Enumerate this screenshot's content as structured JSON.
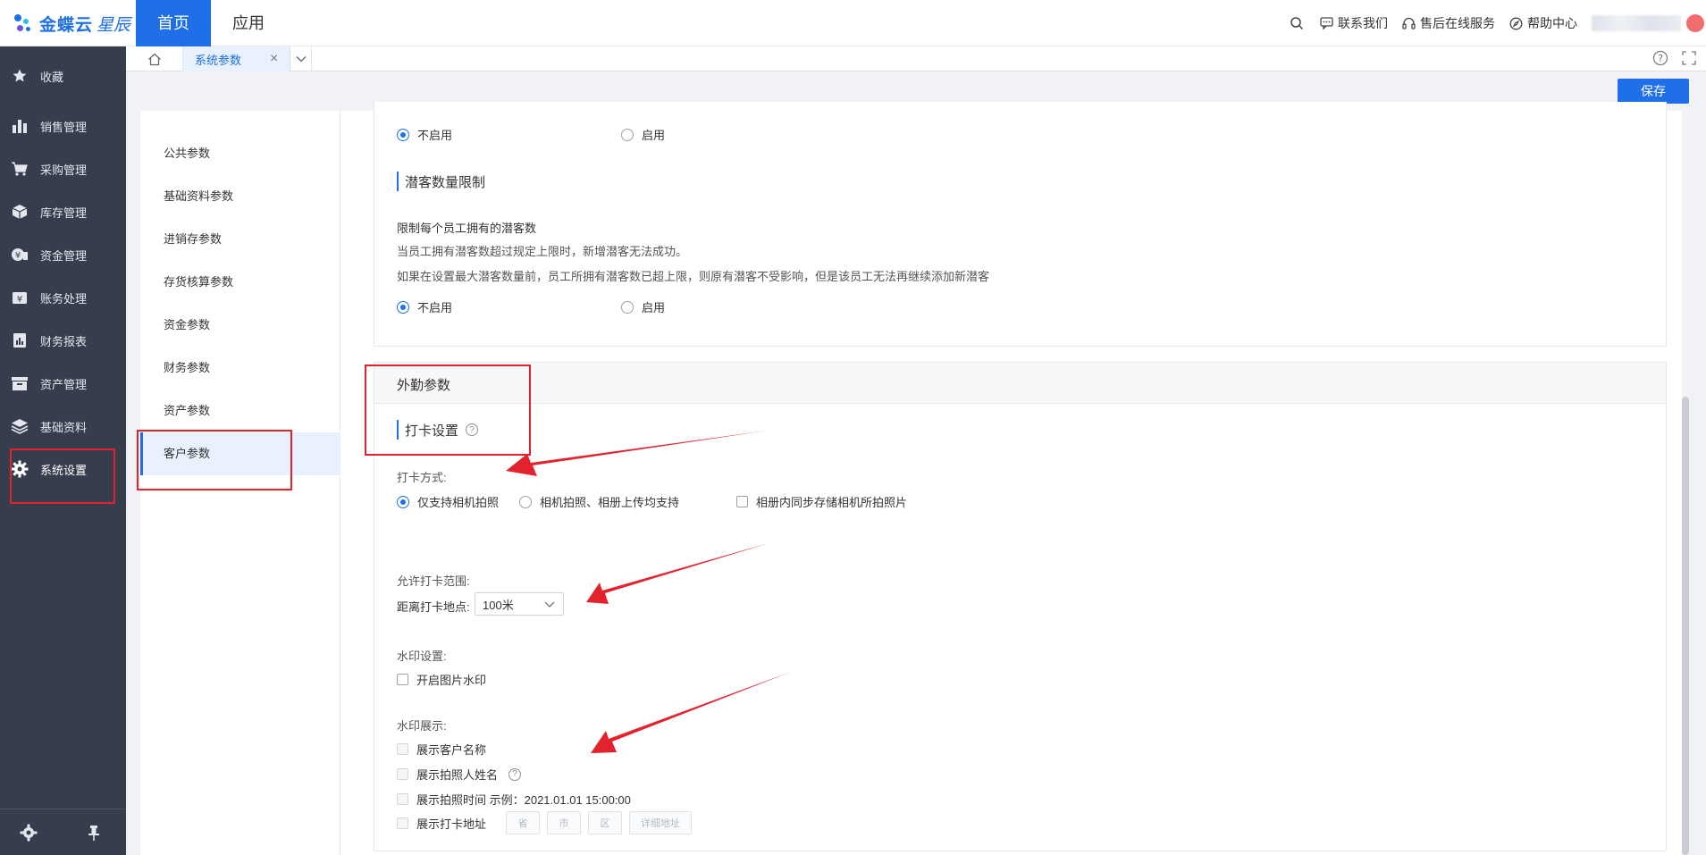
{
  "header": {
    "logo_main": "金蝶云",
    "logo_sub": "星辰",
    "tabs": [
      "首页",
      "应用"
    ],
    "links": [
      "联系我们",
      "售后在线服务",
      "帮助中心"
    ]
  },
  "sidebar": {
    "items": [
      "收藏",
      "销售管理",
      "采购管理",
      "库存管理",
      "资金管理",
      "账务处理",
      "财务报表",
      "资产管理",
      "基础资料",
      "系统设置"
    ]
  },
  "tabstrip": {
    "active_tab": "系统参数"
  },
  "toolbar": {
    "save_label": "保存"
  },
  "subnav": {
    "items": [
      "公共参数",
      "基础资料参数",
      "进销存参数",
      "存货核算参数",
      "资金参数",
      "财务参数",
      "资产参数",
      "客户参数"
    ],
    "active": "客户参数"
  },
  "top_section": {
    "option_off": "不启用",
    "option_on": "启用"
  },
  "lead_limit": {
    "title": "潜客数量限制",
    "line1": "限制每个员工拥有的潜客数",
    "line2": "当员工拥有潜客数超过规定上限时，新增潜客无法成功。",
    "line3": "如果在设置最大潜客数量前，员工所拥有潜客数已超上限，则原有潜客不受影响，但是该员工无法再继续添加新潜客",
    "option_off": "不启用",
    "option_on": "启用"
  },
  "field_work": {
    "header": "外勤参数",
    "checkin_title": "打卡设置",
    "checkin_method_label": "打卡方式:",
    "method_options": [
      "仅支持相机拍照",
      "相机拍照、相册上传均支持"
    ],
    "sync_album_label": "相册内同步存储相机所拍照片",
    "range_label": "允许打卡范围:",
    "distance_label": "距离打卡地点:",
    "distance_value": "100米",
    "watermark_settings_label": "水印设置:",
    "watermark_enable_label": "开启图片水印",
    "watermark_display_label": "水印展示:",
    "show_customer_name": "展示客户名称",
    "show_photographer": "展示拍照人姓名",
    "show_time": "展示拍照时间 示例：2021.01.01 15:00:00",
    "show_address": "展示打卡地址",
    "address_parts": [
      "省",
      "市",
      "区",
      "详细地址"
    ]
  },
  "colors": {
    "accent": "#1e6fe8",
    "sidebar_bg": "#363d4d",
    "annotation": "#e2232d"
  }
}
